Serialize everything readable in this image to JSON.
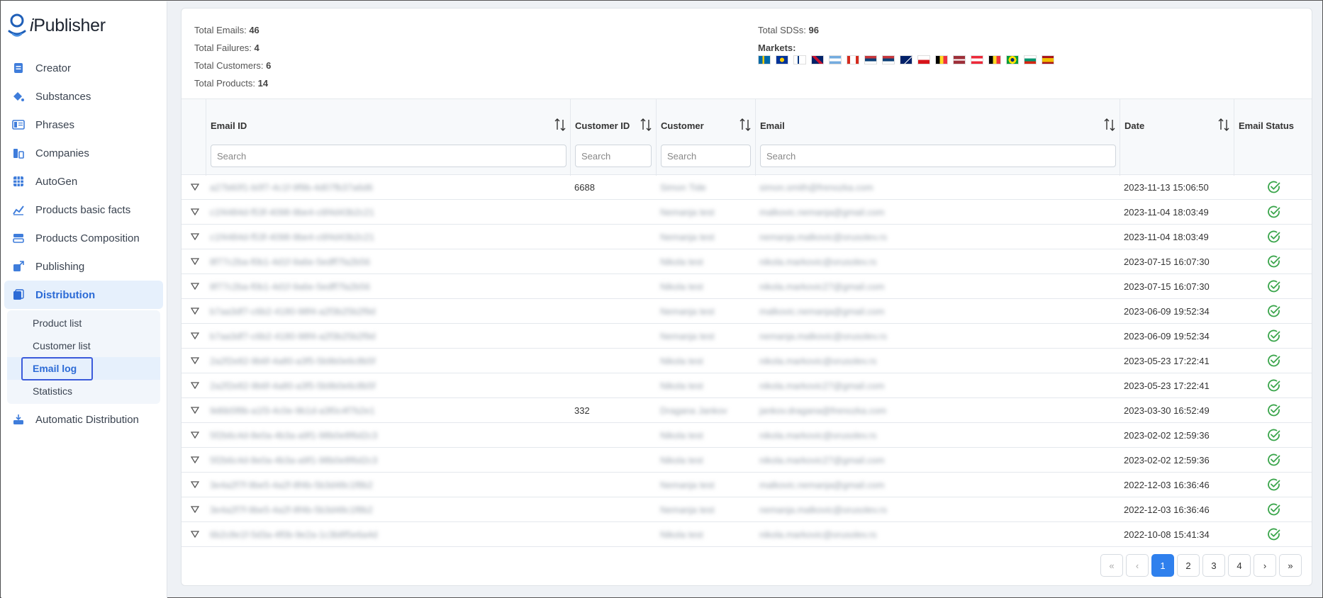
{
  "app": {
    "logo_prefix": "i",
    "logo_name": "Publisher"
  },
  "sidebar": {
    "items": [
      {
        "label": "Creator",
        "icon": "document-icon"
      },
      {
        "label": "Substances",
        "icon": "flask-icon"
      },
      {
        "label": "Phrases",
        "icon": "book-icon"
      },
      {
        "label": "Companies",
        "icon": "building-icon"
      },
      {
        "label": "AutoGen",
        "icon": "grid-icon"
      },
      {
        "label": "Products basic facts",
        "icon": "chart-line-icon"
      },
      {
        "label": "Products Composition",
        "icon": "layers-icon"
      },
      {
        "label": "Publishing",
        "icon": "export-icon"
      },
      {
        "label": "Distribution",
        "icon": "distribution-icon"
      },
      {
        "label": "Automatic Distribution",
        "icon": "inbox-icon"
      }
    ],
    "sub_items": [
      {
        "label": "Product list"
      },
      {
        "label": "Customer list"
      },
      {
        "label": "Email log"
      },
      {
        "label": "Statistics"
      }
    ]
  },
  "stats": {
    "total_emails_label": "Total Emails:",
    "total_emails": "46",
    "total_failures_label": "Total Failures:",
    "total_failures": "4",
    "total_customers_label": "Total Customers:",
    "total_customers": "6",
    "total_products_label": "Total Products:",
    "total_products": "14",
    "total_sds_label": "Total SDSs:",
    "total_sds": "96",
    "markets_label": "Markets:"
  },
  "markets": [
    "SE",
    "EU",
    "FI",
    "GB",
    "AR",
    "CA",
    "RS",
    "RS",
    "AU",
    "CZ",
    "BE",
    "LV",
    "AT",
    "BE",
    "BR",
    "BG",
    "ES"
  ],
  "table": {
    "columns": [
      {
        "label": "Email ID",
        "placeholder": "Search"
      },
      {
        "label": "Customer ID",
        "placeholder": "Search"
      },
      {
        "label": "Customer",
        "placeholder": "Search"
      },
      {
        "label": "Email",
        "placeholder": "Search"
      },
      {
        "label": "Date"
      },
      {
        "label": "Email Status"
      }
    ],
    "rows": [
      {
        "email_id": "a27b60f1-b0f7-4c1f-9f9b-4d07fb37a6d6",
        "customer_id": "6688",
        "customer": "Simon Tide",
        "email": "simon.smith@frenozka.com",
        "date": "2023-11-13 15:06:50"
      },
      {
        "email_id": "c1f4484d-f53f-4098-9be4-c6f4d43b2c21",
        "customer_id": "",
        "customer": "Nemanja test",
        "email": "malkovic.nemanja@gmail.com",
        "date": "2023-11-04 18:03:49"
      },
      {
        "email_id": "c1f4484d-f53f-4098-9be4-c6f4d43b2c21",
        "customer_id": "",
        "customer": "Nemanja test",
        "email": "nemanja.malkovic@orusolev.rs",
        "date": "2023-11-04 18:03:49"
      },
      {
        "email_id": "8f77c2ba-f0b1-4d1f-9a6e-5edff7fa2b56",
        "customer_id": "",
        "customer": "Nikola test",
        "email": "nikola.markovic@orusolev.rs",
        "date": "2023-07-15 16:07:30"
      },
      {
        "email_id": "8f77c2ba-f0b1-4d1f-9a6e-5edff7fa2b56",
        "customer_id": "",
        "customer": "Nikola test",
        "email": "nikola.markovic27@gmail.com",
        "date": "2023-07-15 16:07:30"
      },
      {
        "email_id": "b7aa3df7-c6b2-4180-98f4-a2f3b25b2f9d",
        "customer_id": "",
        "customer": "Nemanja test",
        "email": "malkovic.nemanja@gmail.com",
        "date": "2023-06-09 19:52:34"
      },
      {
        "email_id": "b7aa3df7-c6b2-4180-98f4-a2f3b25b2f9d",
        "customer_id": "",
        "customer": "Nemanja test",
        "email": "nemanja.malkovic@orusolev.rs",
        "date": "2023-06-09 19:52:34"
      },
      {
        "email_id": "2a2f2e82-9b6f-4a80-a3f5-5b9b0e6c8b5f",
        "customer_id": "",
        "customer": "Nikola test",
        "email": "nikola.markovic@orusolev.rs",
        "date": "2023-05-23 17:22:41"
      },
      {
        "email_id": "2a2f2e82-9b6f-4a80-a3f5-5b9b0e6c8b5f",
        "customer_id": "",
        "customer": "Nikola test",
        "email": "nikola.markovic27@gmail.com",
        "date": "2023-05-23 17:22:41"
      },
      {
        "email_id": "9d6b5f8b-a1f3-4c0e-9b1d-a3f0c4f7b2e1",
        "customer_id": "332",
        "customer": "Dragana Jankov",
        "email": "jankov.dragana@frenozka.com",
        "date": "2023-03-30 16:52:49"
      },
      {
        "email_id": "5f2b6c4d-8e0a-4b3a-a9f1-98b0e8f6d2c3",
        "customer_id": "",
        "customer": "Nikola test",
        "email": "nikola.markovic@orusolev.rs",
        "date": "2023-02-02 12:59:36"
      },
      {
        "email_id": "5f2b6c4d-8e0a-4b3a-a9f1-98b0e8f6d2c3",
        "customer_id": "",
        "customer": "Nikola test",
        "email": "nikola.markovic27@gmail.com",
        "date": "2023-02-02 12:59:36"
      },
      {
        "email_id": "3e4a2f7f-9be5-4a2f-8f4b-5b3d48c1f8b2",
        "customer_id": "",
        "customer": "Nemanja test",
        "email": "malkovic.nemanja@gmail.com",
        "date": "2022-12-03 16:36:46"
      },
      {
        "email_id": "3e4a2f7f-9be5-4a2f-8f4b-5b3d48c1f8b2",
        "customer_id": "",
        "customer": "Nemanja test",
        "email": "nemanja.malkovic@orusolev.rs",
        "date": "2022-12-03 16:36:46"
      },
      {
        "email_id": "6b2c8e1f-5d3a-4f0b-9e2a-1c3b8f5e6a4d",
        "customer_id": "",
        "customer": "Nikola test",
        "email": "nikola.markovic@orusolev.rs",
        "date": "2022-10-08 15:41:34"
      }
    ]
  },
  "pagination": {
    "pages": [
      "1",
      "2",
      "3",
      "4"
    ],
    "current": "1",
    "first": "«",
    "prev": "‹",
    "next": "›",
    "last": "»"
  },
  "colors": {
    "accent": "#2f80ed",
    "active_nav_bg": "#e6f0fc",
    "status_ok": "#3aa54b"
  }
}
